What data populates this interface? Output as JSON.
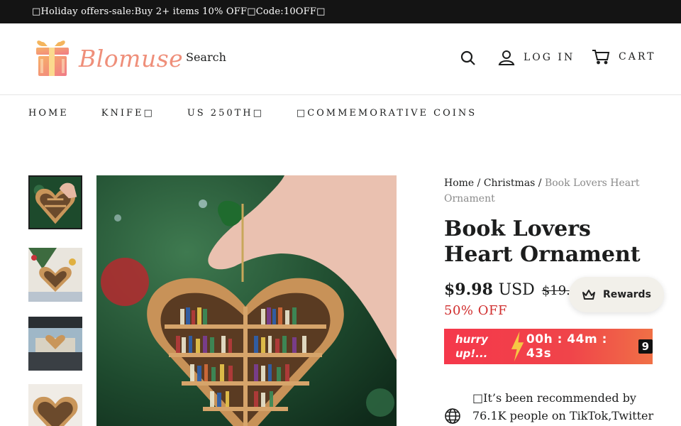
{
  "announcement": "□Holiday offers-sale:Buy 2+ items 10% OFF□Code:10OFF□",
  "logo": {
    "text": "Blomuse"
  },
  "header": {
    "search_label": "Search",
    "login_label": "LOG IN",
    "cart_label": "CART",
    "icons": [
      "search-icon",
      "user-icon",
      "cart-icon"
    ]
  },
  "nav": {
    "items": [
      "HOME",
      "KNIFE□",
      "US 250TH□",
      "□COMMEMORATIVE COINS"
    ]
  },
  "breadcrumb": {
    "home": "Home",
    "sep": "/",
    "category": "Christmas",
    "current": "Book Lovers Heart Ornament"
  },
  "product": {
    "title": "Book Lovers Heart Ornament",
    "price": "$9.98",
    "currency": "USD",
    "compare_price": "$19.96",
    "discount": "50% OFF"
  },
  "countdown": {
    "hurry": "hurry up!...",
    "time": "00h : 44m : 43s",
    "seconds_box": "9"
  },
  "rewards": {
    "label": "Rewards"
  },
  "recommendation": {
    "text": "□It’s been recommended by 76.1K people on TikTok,Twitter"
  },
  "colors": {
    "announcement_bg": "#141414",
    "sale_red": "#d02e2e",
    "timer_gradient_start": "#f5384b",
    "timer_gradient_end": "#f07046",
    "logo_pink": "#ef8f7a"
  }
}
